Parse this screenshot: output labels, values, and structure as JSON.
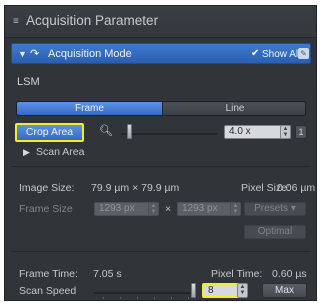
{
  "panel": {
    "title": "Acquisition Parameter",
    "title_icon": "menu-icon"
  },
  "section": {
    "title": "Acquisition Mode",
    "show_all_label": "Show All",
    "collapse_icon": "chevron-down-icon",
    "arrow_icon": "curved-arrow-icon",
    "show_all_check_icon": "checkmark-icon",
    "edit_icon": "pencil-icon",
    "header_color": "#3a72c8"
  },
  "lsm": {
    "label": "LSM",
    "tabs": [
      {
        "label": "Frame",
        "selected": true
      },
      {
        "label": "Line",
        "selected": false
      }
    ],
    "crop_area_label": "Crop Area",
    "zoom_icon": "magnifier-icon",
    "zoom_value": "4.0 x",
    "zoom_reset_label": "1",
    "scan_area_label": "Scan Area",
    "scan_area_icon": "chevron-right-icon",
    "highlight_color": "#f4ef1e",
    "accent_color": "#4a84d8"
  },
  "image": {
    "image_size_label": "Image Size:",
    "image_size_value": "79.9 µm × 79.9 µm",
    "pixel_size_label": "Pixel Size:",
    "pixel_size_value": "0.06 µm",
    "frame_size_label": "Frame Size",
    "frame_width": "1293 px",
    "frame_height": "1293 px",
    "times_symbol": "×",
    "presets_label": "Presets ▾",
    "optimal_label": "Optimal"
  },
  "timing": {
    "frame_time_label": "Frame Time:",
    "frame_time_value": "7.05 s",
    "pixel_time_label": "Pixel Time:",
    "pixel_time_value": "0.60 µs",
    "scan_speed_label": "Scan Speed",
    "scan_speed_value": "8",
    "max_label": "Max"
  }
}
